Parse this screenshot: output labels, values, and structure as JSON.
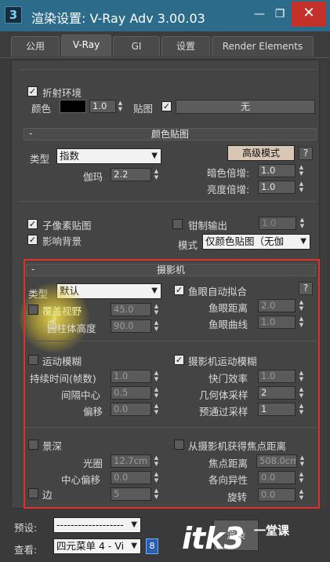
{
  "window": {
    "title": "渲染设置: V-Ray Adv 3.00.03",
    "app_icon_text": "3",
    "minimize": "—",
    "restore": "❐",
    "close": "✕"
  },
  "tabs": [
    {
      "label": "公用"
    },
    {
      "label": "V-Ray"
    },
    {
      "label": "GI"
    },
    {
      "label": "设置"
    },
    {
      "label": "Render Elements"
    }
  ],
  "refraction_env": {
    "checkbox_label": "折射环境",
    "color_label": "颜色",
    "color_value": "1.0",
    "map_label": "贴图",
    "map_button": "无"
  },
  "color_mapping": {
    "header": "颜色贴图",
    "type_label": "类型",
    "type_value": "指数",
    "expert_button": "高级模式",
    "help_button": "?",
    "gamma_label": "伽玛",
    "gamma_value": "2.2",
    "dark_mult_label": "暗色倍增:",
    "dark_mult_value": "1.0",
    "bright_mult_label": "亮度倍增:",
    "bright_mult_value": "1.0",
    "subpixel_label": "子像素贴图",
    "clamp_label": "钳制输出",
    "clamp_value": "1.0",
    "affect_bg_label": "影响背景",
    "mode_label": "模式",
    "mode_value": "仅颜色贴图（无伽"
  },
  "camera": {
    "header": "摄影机",
    "type_label": "类型",
    "type_value": "默认",
    "fisheye_auto_label": "鱼眼自动拟合",
    "help_button": "?",
    "override_fov_label": "覆盖视野",
    "override_fov_value": "45.0",
    "cylinder_height_label": "圆柱体高度",
    "cylinder_height_value": "90.0",
    "fisheye_dist_label": "鱼眼距离",
    "fisheye_dist_value": "2.0",
    "fisheye_curve_label": "鱼眼曲线",
    "fisheye_curve_value": "1.0",
    "motion_blur_label": "运动模糊",
    "duration_label": "持续时间(帧数)",
    "duration_value": "1.0",
    "interval_center_label": "间隔中心",
    "interval_center_value": "0.5",
    "bias_label": "偏移",
    "bias_value": "0.0",
    "camera_motion_blur_label": "摄影机运动模糊",
    "shutter_eff_label": "快门效率",
    "shutter_eff_value": "1.0",
    "geometry_samples_label": "几何体采样",
    "geometry_samples_value": "2",
    "prepass_samples_label": "预通过采样",
    "prepass_samples_value": "1",
    "dof_label": "景深",
    "get_focal_label": "从摄影机获得焦点距离",
    "aperture_label": "光圈",
    "aperture_value": "12.7cm",
    "focal_dist_label": "焦点距离",
    "focal_dist_value": "508.0cm",
    "center_bias_label": "中心偏移",
    "center_bias_value": "0.0",
    "anisotropy_label": "各向异性",
    "anisotropy_value": "0.0",
    "sides_label": "边",
    "sides_value": "5",
    "rotation_label": "旋转",
    "rotation_value": "0.0"
  },
  "bottom": {
    "preset_label": "预设:",
    "preset_value": "-------------------",
    "view_label": "查看:",
    "view_value": "四元菜单 4 - Vi",
    "render_button": "渲染",
    "watermark": "itk3",
    "watermark_sub": "一堂课"
  },
  "colors": {
    "highlight_box": "#e0302a",
    "titlebar": "#2d6b8a",
    "close": "#c4312b"
  }
}
